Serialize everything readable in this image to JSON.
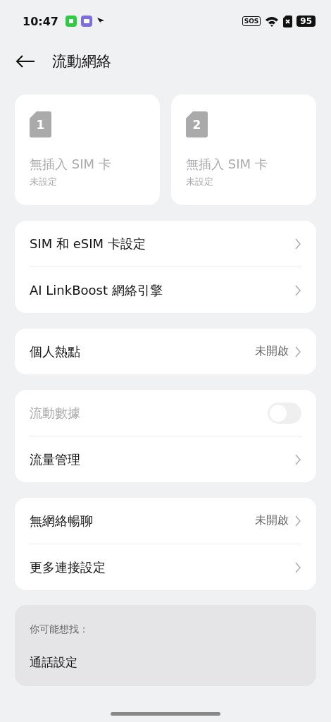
{
  "status_bar": {
    "time": "10:47",
    "sos": "SOS",
    "battery": "95"
  },
  "header": {
    "title": "流動網絡"
  },
  "sim_cards": [
    {
      "number": "1",
      "title": "無插入 SIM 卡",
      "subtitle": "未設定"
    },
    {
      "number": "2",
      "title": "無插入 SIM 卡",
      "subtitle": "未設定"
    }
  ],
  "groups": [
    {
      "rows": [
        {
          "kind": "link",
          "label": "SIM 和 eSIM 卡設定",
          "disabled": false
        },
        {
          "kind": "link",
          "label": "AI LinkBoost 網絡引擎",
          "disabled": false
        }
      ]
    },
    {
      "rows": [
        {
          "kind": "link",
          "label": "個人熱點",
          "value": "未開啟",
          "disabled": false
        }
      ]
    },
    {
      "rows": [
        {
          "kind": "toggle",
          "label": "流動數據",
          "on": false,
          "disabled": true
        },
        {
          "kind": "link",
          "label": "流量管理",
          "disabled": false
        }
      ]
    },
    {
      "rows": [
        {
          "kind": "link",
          "label": "無網絡暢聊",
          "value": "未開啟",
          "disabled": false
        },
        {
          "kind": "link",
          "label": "更多連接設定",
          "disabled": false
        }
      ]
    }
  ],
  "suggestions": {
    "heading": "你可能想找：",
    "items": [
      "通話設定"
    ]
  }
}
